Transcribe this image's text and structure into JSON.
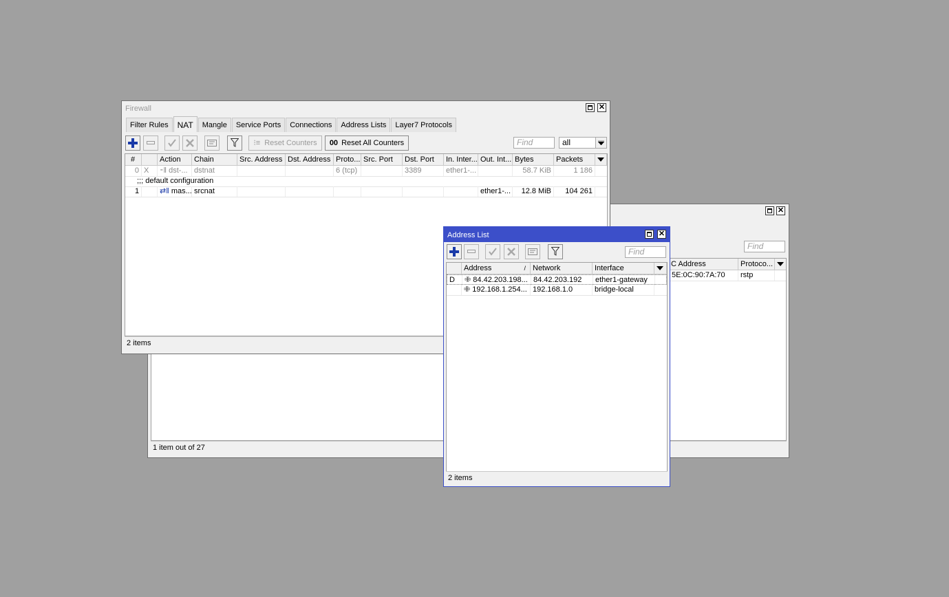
{
  "back_window": {
    "find_placeholder": "Find",
    "columns": [
      "C Address",
      "Protoco..."
    ],
    "row": {
      "mac": "5E:0C:90:7A:70",
      "protocol": "rstp"
    },
    "status": "1 item out of 27"
  },
  "firewall": {
    "title": "Firewall",
    "tabs": [
      "Filter Rules",
      "NAT",
      "Mangle",
      "Service Ports",
      "Connections",
      "Address Lists",
      "Layer7 Protocols"
    ],
    "active_tab": "NAT",
    "toolbar": {
      "reset_counters": "Reset Counters",
      "reset_all_counters": "Reset All Counters",
      "reset_all_icon_text": "00",
      "find_placeholder": "Find",
      "filter_value": "all"
    },
    "columns": [
      "#",
      "",
      "Action",
      "Chain",
      "Src. Address",
      "Dst. Address",
      "Proto...",
      "Src. Port",
      "Dst. Port",
      "In. Inter...",
      "Out. Int...",
      "Bytes",
      "Packets"
    ],
    "rows": [
      {
        "num": "0",
        "flag": "X",
        "action": "dst-...",
        "chain": "dstnat",
        "src_address": "",
        "dst_address": "",
        "protocol": "6 (tcp)",
        "src_port": "",
        "dst_port": "3389",
        "in_interface": "ether1-...",
        "out_interface": "",
        "bytes": "58.7 KiB",
        "packets": "1 186",
        "disabled": true
      },
      {
        "comment": ";;; default configuration"
      },
      {
        "num": "1",
        "flag": "",
        "action": "mas...",
        "chain": "srcnat",
        "src_address": "",
        "dst_address": "",
        "protocol": "",
        "src_port": "",
        "dst_port": "",
        "in_interface": "",
        "out_interface": "ether1-...",
        "bytes": "12.8 MiB",
        "packets": "104 261",
        "disabled": false
      }
    ],
    "status": "2 items"
  },
  "address_list": {
    "title": "Address List",
    "find_placeholder": "Find",
    "columns": [
      "Address",
      "Network",
      "Interface"
    ],
    "sort_indicator": "/",
    "rows": [
      {
        "flag": "D",
        "address": "84.42.203.198...",
        "network": "84.42.203.192",
        "interface": "ether1-gateway"
      },
      {
        "flag": "",
        "address": "192.168.1.254...",
        "network": "192.168.1.0",
        "interface": "bridge-local"
      }
    ],
    "status": "2 items"
  },
  "colors": {
    "desktop": "#a0a0a0",
    "active_title": "#3c4fc9",
    "add_icon": "#1a3aa8"
  }
}
